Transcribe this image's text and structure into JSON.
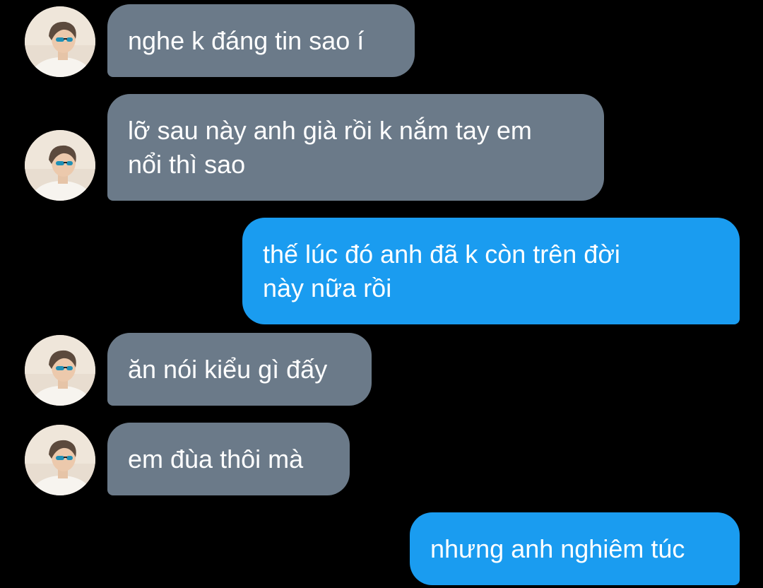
{
  "messages": [
    {
      "direction": "incoming",
      "text": "nghe k đáng tin sao í"
    },
    {
      "direction": "incoming",
      "text": "lỡ sau này anh già rồi k nắm tay em\nnổi thì sao"
    },
    {
      "direction": "outgoing",
      "text": "thế lúc đó anh đã k còn trên đời\nnày nữa rồi"
    },
    {
      "direction": "incoming",
      "text": "ăn nói kiểu gì đấy"
    },
    {
      "direction": "incoming",
      "text": "em đùa thôi mà"
    },
    {
      "direction": "outgoing",
      "text": "nhưng anh nghiêm túc"
    }
  ],
  "colors": {
    "background": "#000000",
    "incoming_bubble": "#6b7a89",
    "outgoing_bubble": "#1a9cf0",
    "text": "#ffffff"
  },
  "icons": {
    "avatar": "contact-avatar-photo"
  }
}
